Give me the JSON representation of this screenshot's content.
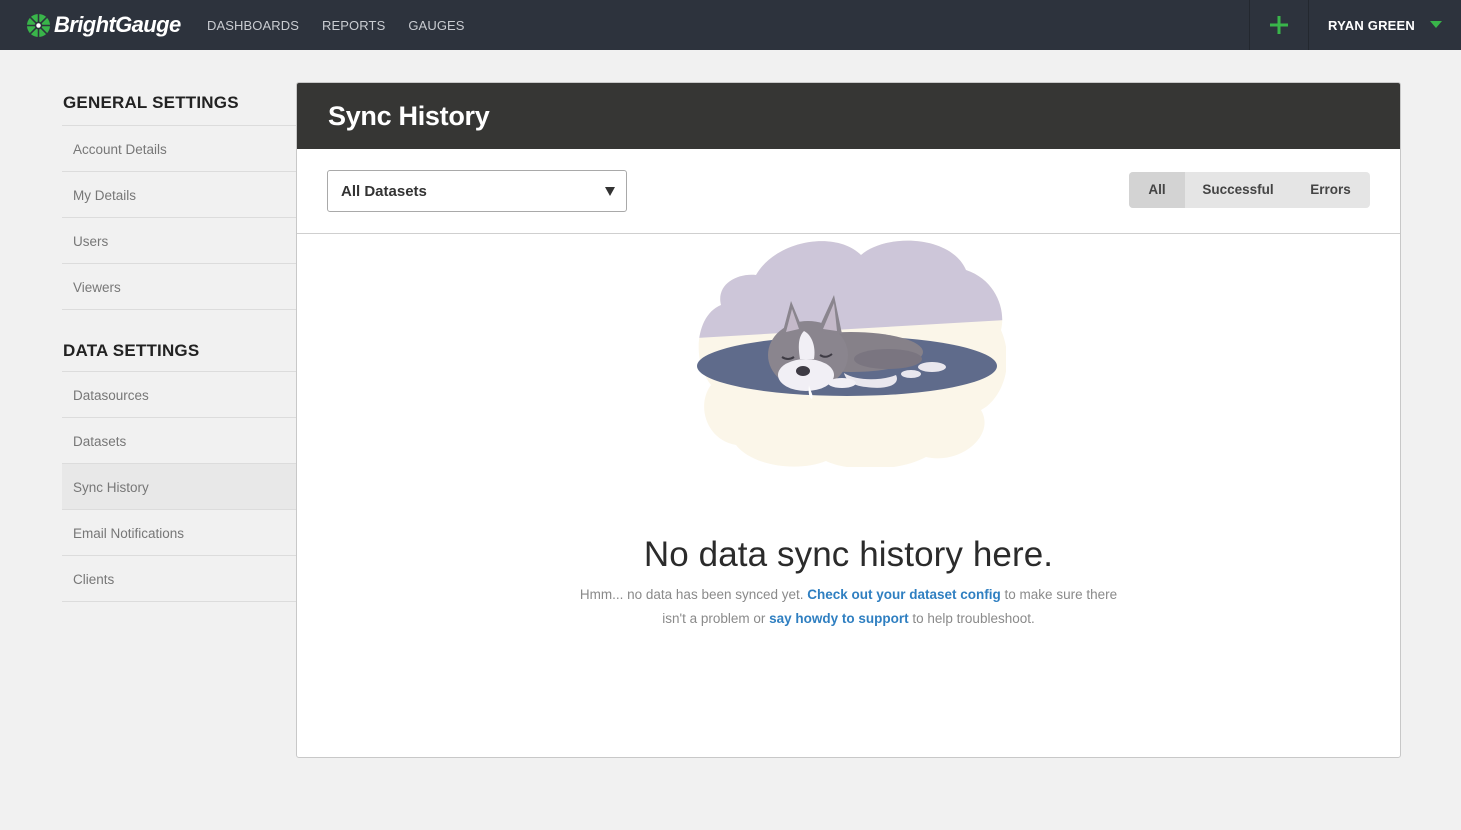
{
  "brand": {
    "name": "BrightGauge",
    "accent_color": "#39b54a"
  },
  "nav": {
    "links": [
      "DASHBOARDS",
      "REPORTS",
      "GAUGES"
    ],
    "add_icon": "plus-icon",
    "user_name": "RYAN GREEN",
    "user_menu_icon": "caret-down-icon"
  },
  "sidebar": {
    "general_title": "GENERAL SETTINGS",
    "general_items": [
      "Account Details",
      "My Details",
      "Users",
      "Viewers"
    ],
    "data_title": "DATA SETTINGS",
    "data_items": [
      "Datasources",
      "Datasets",
      "Sync History",
      "Email Notifications",
      "Clients"
    ],
    "active_item": "Sync History"
  },
  "panel": {
    "title": "Sync History",
    "dataset_select": {
      "selected": "All Datasets"
    },
    "filters": [
      "All",
      "Successful",
      "Errors"
    ],
    "active_filter": "All"
  },
  "empty_state": {
    "illustration": "sleeping-dog-illustration",
    "title": "No data sync history here.",
    "text_before": "Hmm... no data has been synced yet. ",
    "link_config": "Check out your dataset config",
    "text_middle": " to make sure there isn't a problem or ",
    "link_support": "say howdy to support",
    "text_after": " to help troubleshoot."
  }
}
